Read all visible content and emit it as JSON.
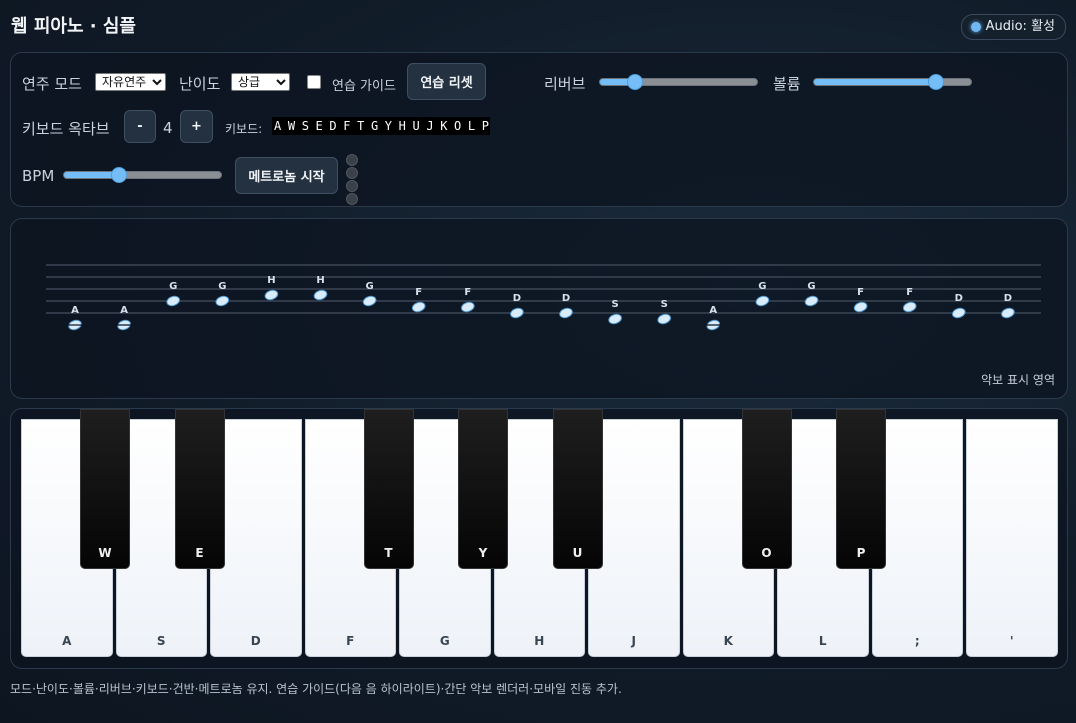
{
  "header": {
    "title": "웹 피아노 · 심플"
  },
  "audio": {
    "label": "Audio: 활성",
    "status_color": "#6fb8f2"
  },
  "controls": {
    "mode_label": "연주 모드",
    "mode_value": "자유연주",
    "difficulty_label": "난이도",
    "difficulty_value": "상급",
    "guide_label": "연습 가이드",
    "guide_checked": false,
    "reset_button": "연습 리셋",
    "reverb_label": "리버브",
    "reverb_level": 0.22,
    "volume_label": "볼륨",
    "volume_level": 0.78,
    "octave_label": "키보드 옥타브",
    "octave_minus": "-",
    "octave_value": "4",
    "octave_plus": "+",
    "keyboard_label": "키보드:",
    "keyboard_map": "A W S E D F T G Y H U J K O L P ; '",
    "bpm_label": "BPM",
    "bpm_level": 0.35,
    "metronome_button": "메트로놈 시작",
    "accent_color": "#74bdf6"
  },
  "score": {
    "caption": "악보 표시 영역",
    "notes": [
      {
        "key": "A",
        "step": 0
      },
      {
        "key": "A",
        "step": 0
      },
      {
        "key": "G",
        "step": 4
      },
      {
        "key": "G",
        "step": 4
      },
      {
        "key": "H",
        "step": 5
      },
      {
        "key": "H",
        "step": 5
      },
      {
        "key": "G",
        "step": 4
      },
      {
        "key": "F",
        "step": 3
      },
      {
        "key": "F",
        "step": 3
      },
      {
        "key": "D",
        "step": 2
      },
      {
        "key": "D",
        "step": 2
      },
      {
        "key": "S",
        "step": 1
      },
      {
        "key": "S",
        "step": 1
      },
      {
        "key": "A",
        "step": 0
      },
      {
        "key": "G",
        "step": 4
      },
      {
        "key": "G",
        "step": 4
      },
      {
        "key": "F",
        "step": 3
      },
      {
        "key": "F",
        "step": 3
      },
      {
        "key": "D",
        "step": 2
      },
      {
        "key": "D",
        "step": 2
      }
    ]
  },
  "piano": {
    "white_keys": [
      "A",
      "S",
      "D",
      "F",
      "G",
      "H",
      "J",
      "K",
      "L",
      ";",
      "'"
    ],
    "black_keys": [
      {
        "label": "W",
        "after": 0
      },
      {
        "label": "E",
        "after": 1
      },
      {
        "label": "T",
        "after": 3
      },
      {
        "label": "Y",
        "after": 4
      },
      {
        "label": "U",
        "after": 5
      },
      {
        "label": "O",
        "after": 7
      },
      {
        "label": "P",
        "after": 8
      }
    ]
  },
  "footer": {
    "text": "모드·난이도·볼륨·리버브·키보드·건반·메트로놈 유지. 연습 가이드(다음 음 하이라이트)·간단 악보 렌더러·모바일 진동 추가."
  }
}
